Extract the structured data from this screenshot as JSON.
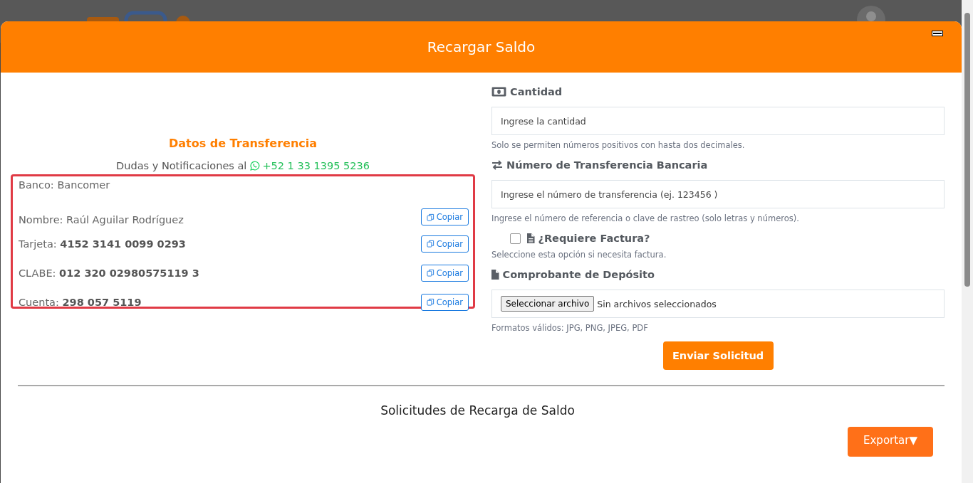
{
  "modal": {
    "title": "Recargar Saldo"
  },
  "transfer_info": {
    "title": "Datos de Transferencia",
    "contact_label": "Dudas y Notificaciones al",
    "phone": "+52 1 33 1395 5236",
    "rows": [
      {
        "label": "Banco:",
        "value": "Bancomer",
        "value_bold": false
      },
      {
        "label": "Nombre:",
        "value": "Raúl Aguilar Rodríguez",
        "value_bold": false,
        "copy_button": "Copiar"
      },
      {
        "label": "Tarjeta:",
        "value": "4152 3141 0099 0293",
        "value_bold": true,
        "copy_button": "Copiar"
      },
      {
        "label": "CLABE:",
        "value": "012 320 02980575119 3",
        "value_bold": true,
        "copy_button": "Copiar"
      },
      {
        "label": "Cuenta:",
        "value": "298 057 5119",
        "value_bold": true,
        "copy_button": "Copiar"
      }
    ]
  },
  "form": {
    "fields": [
      {
        "kind": "text",
        "label": "Cantidad",
        "placeholder": "Ingrese la cantidad",
        "help": "Solo se permiten números positivos con hasta dos decimales."
      },
      {
        "kind": "text",
        "label": "Número de Transferencia Bancaria",
        "placeholder": "Ingrese el número de transferencia (ej. 123456 )",
        "help": "Ingrese el número de referencia o clave de rastreo (solo letras y números)."
      },
      {
        "kind": "checkbox",
        "label": "¿Requiere Factura?",
        "checked": false,
        "help": "Seleccione esta opción si necesita factura."
      },
      {
        "kind": "file",
        "label": "Comprobante de Depósito",
        "button": "Seleccionar archivo",
        "status": "Sin archivos seleccionados",
        "help": "Formatos válidos: JPG, PNG, JPEG, PDF"
      }
    ],
    "submit": "Enviar Solicitud"
  },
  "requests": {
    "title": "Solicitudes de Recarga de Saldo",
    "export_button": "Exportar▼"
  }
}
